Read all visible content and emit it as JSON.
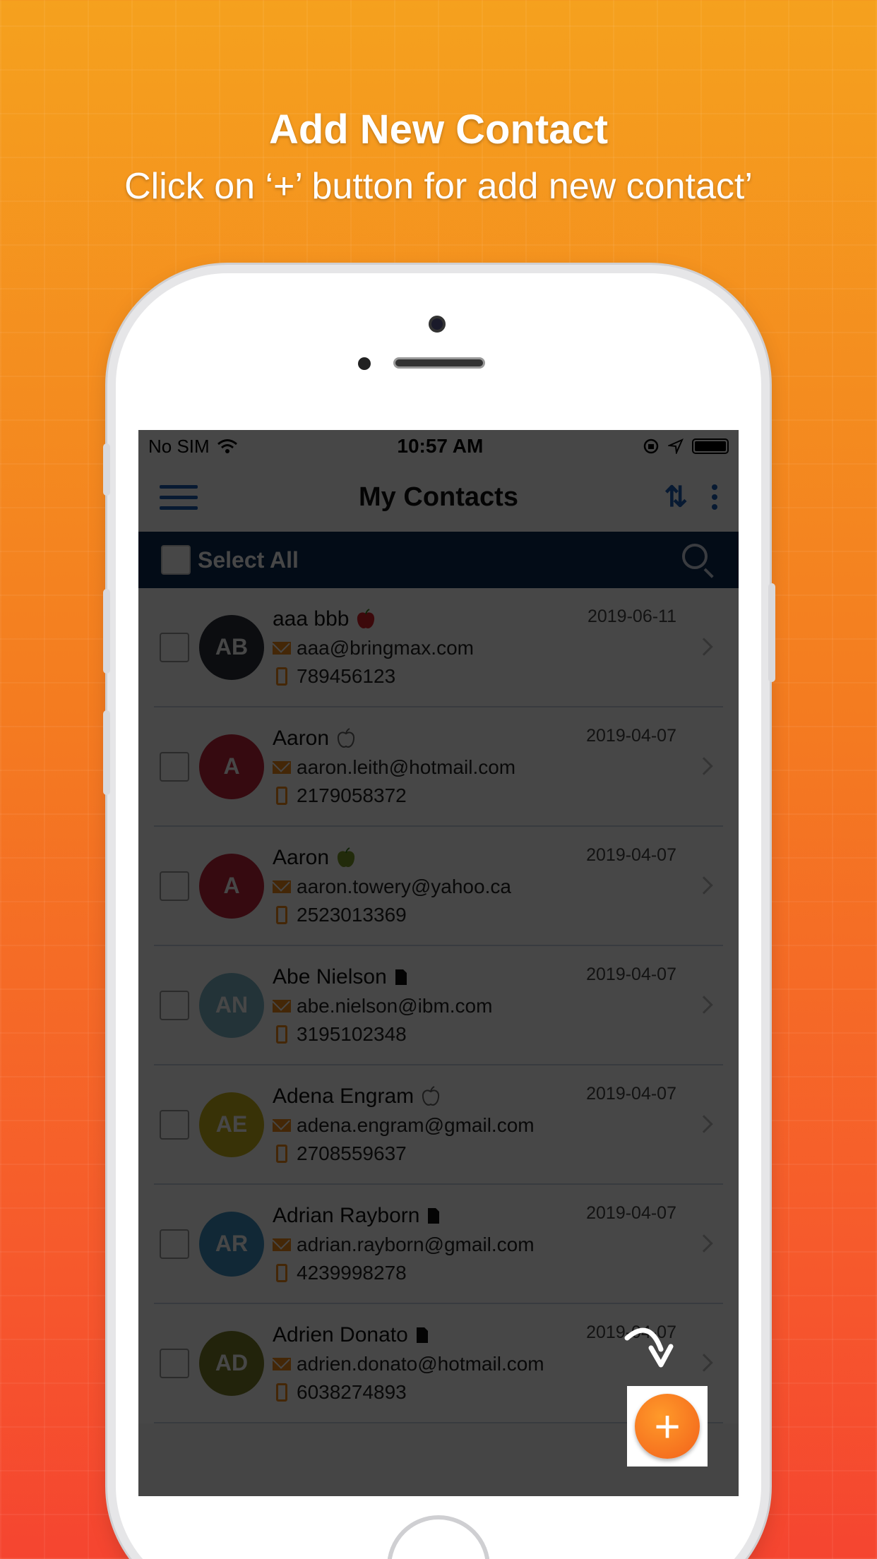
{
  "promo": {
    "title": "Add New Contact",
    "subtitle": "Click on ‘+’ button for add  new contact’"
  },
  "status_bar": {
    "carrier": "No SIM",
    "time": "10:57 AM"
  },
  "header": {
    "title": "My Contacts",
    "menu_icon": "hamburger-icon",
    "sort_icon": "sort-arrows-icon",
    "more_icon": "more-vertical-icon"
  },
  "select_bar": {
    "label": "Select All",
    "search_icon": "search-icon"
  },
  "contacts": [
    {
      "initials": "AB",
      "name": "aaa bbb",
      "email": "aaa@bringmax.com",
      "phone": "789456123",
      "date": "2019-06-11",
      "avatar_color": "#2b2f3a",
      "source": "apple-red"
    },
    {
      "initials": "A",
      "name": "Aaron",
      "email": "aaron.leith@hotmail.com",
      "phone": "2179058372",
      "date": "2019-04-07",
      "avatar_color": "#c0243a",
      "source": "apple-outline"
    },
    {
      "initials": "A",
      "name": "Aaron",
      "email": "aaron.towery@yahoo.ca",
      "phone": "2523013369",
      "date": "2019-04-07",
      "avatar_color": "#c0243a",
      "source": "apple-green"
    },
    {
      "initials": "AN",
      "name": "Abe Nielson",
      "email": "abe.nielson@ibm.com",
      "phone": "3195102348",
      "date": "2019-04-07",
      "avatar_color": "#7fb8c8",
      "source": "sim-card"
    },
    {
      "initials": "AE",
      "name": "Adena Engram",
      "email": "adena.engram@gmail.com",
      "phone": "2708559637",
      "date": "2019-04-07",
      "avatar_color": "#c9b21a",
      "source": "apple-outline"
    },
    {
      "initials": "AR",
      "name": "Adrian Rayborn",
      "email": "adrian.rayborn@gmail.com",
      "phone": "4239998278",
      "date": "2019-04-07",
      "avatar_color": "#3f8fc2",
      "source": "sim-card"
    },
    {
      "initials": "AD",
      "name": "Adrien Donato",
      "email": "adrien.donato@hotmail.com",
      "phone": "6038274893",
      "date": "2019-04-07",
      "avatar_color": "#7a7d2a",
      "source": "sim-card"
    }
  ],
  "fab": {
    "label": "+",
    "icon": "plus-icon"
  }
}
